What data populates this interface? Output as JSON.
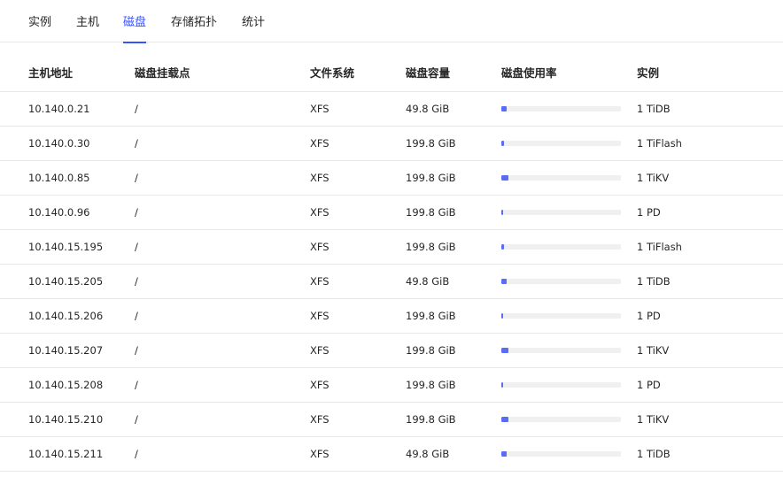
{
  "tabs": [
    {
      "label": "实例",
      "active": false
    },
    {
      "label": "主机",
      "active": false
    },
    {
      "label": "磁盘",
      "active": true
    },
    {
      "label": "存储拓扑",
      "active": false
    },
    {
      "label": "统计",
      "active": false
    }
  ],
  "table": {
    "headers": [
      "主机地址",
      "磁盘挂载点",
      "文件系统",
      "磁盘容量",
      "磁盘使用率",
      "实例"
    ],
    "rows": [
      {
        "host": "10.140.0.21",
        "mount": "/",
        "fs": "XFS",
        "capacity": "49.8 GiB",
        "usage": 0.045,
        "instance": "1 TiDB"
      },
      {
        "host": "10.140.0.30",
        "mount": "/",
        "fs": "XFS",
        "capacity": "199.8 GiB",
        "usage": 0.022,
        "instance": "1 TiFlash"
      },
      {
        "host": "10.140.0.85",
        "mount": "/",
        "fs": "XFS",
        "capacity": "199.8 GiB",
        "usage": 0.06,
        "instance": "1 TiKV"
      },
      {
        "host": "10.140.0.96",
        "mount": "/",
        "fs": "XFS",
        "capacity": "199.8 GiB",
        "usage": 0.008,
        "instance": "1 PD"
      },
      {
        "host": "10.140.15.195",
        "mount": "/",
        "fs": "XFS",
        "capacity": "199.8 GiB",
        "usage": 0.022,
        "instance": "1 TiFlash"
      },
      {
        "host": "10.140.15.205",
        "mount": "/",
        "fs": "XFS",
        "capacity": "49.8 GiB",
        "usage": 0.045,
        "instance": "1 TiDB"
      },
      {
        "host": "10.140.15.206",
        "mount": "/",
        "fs": "XFS",
        "capacity": "199.8 GiB",
        "usage": 0.008,
        "instance": "1 PD"
      },
      {
        "host": "10.140.15.207",
        "mount": "/",
        "fs": "XFS",
        "capacity": "199.8 GiB",
        "usage": 0.06,
        "instance": "1 TiKV"
      },
      {
        "host": "10.140.15.208",
        "mount": "/",
        "fs": "XFS",
        "capacity": "199.8 GiB",
        "usage": 0.008,
        "instance": "1 PD"
      },
      {
        "host": "10.140.15.210",
        "mount": "/",
        "fs": "XFS",
        "capacity": "199.8 GiB",
        "usage": 0.06,
        "instance": "1 TiKV"
      },
      {
        "host": "10.140.15.211",
        "mount": "/",
        "fs": "XFS",
        "capacity": "49.8 GiB",
        "usage": 0.045,
        "instance": "1 TiDB"
      }
    ]
  },
  "colors": {
    "accent": "#3751ff",
    "bar_fill": "#5a6df0",
    "bar_track": "#f0f0f0",
    "divider": "#e8e8e8"
  }
}
